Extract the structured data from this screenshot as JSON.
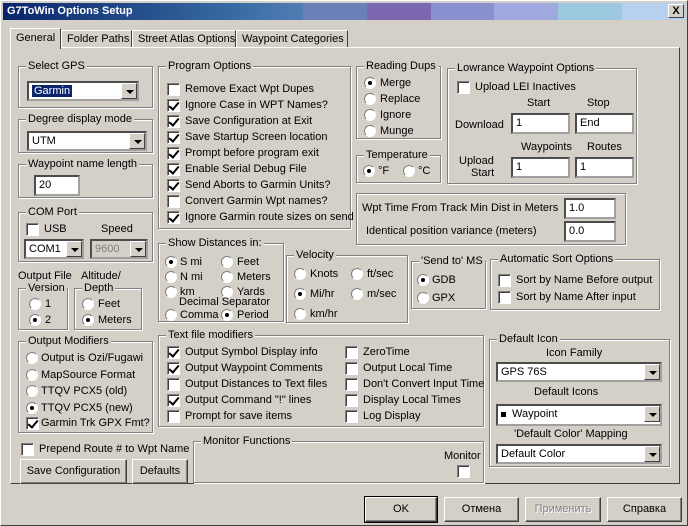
{
  "window": {
    "title": "G7ToWin Options Setup",
    "close": "X"
  },
  "tabs": [
    "General",
    "Folder Paths",
    "Street Atlas Options",
    "Waypoint  Categories"
  ],
  "select_gps": {
    "legend": "Select GPS",
    "value": "Garmin"
  },
  "degree": {
    "legend": "Degree display mode",
    "value": "UTM"
  },
  "wpt_name_len": {
    "legend": "Waypoint name length",
    "value": "20"
  },
  "com_port": {
    "legend": "COM Port",
    "usb": "USB",
    "speed_label": "Speed",
    "port": "COM1",
    "speed": "9600"
  },
  "output_file": {
    "label": "Output File",
    "version_legend": "Version",
    "v1": "1",
    "v2": "2"
  },
  "altitude": {
    "label": "Altitude/",
    "legend": "Depth",
    "feet": "Feet",
    "meters": "Meters"
  },
  "output_modifiers": {
    "legend": "Output Modifiers",
    "items": [
      "Output is Ozi/Fugawi",
      "MapSource Format",
      "TTQV PCX5 (old)",
      "TTQV PCX5 (new)",
      "Garmin Trk GPX Fmt?"
    ]
  },
  "prepend": "Prepend Route # to Wpt Name",
  "buttons": {
    "save_config": "Save Configuration",
    "defaults": "Defaults",
    "ok": "OK",
    "cancel": "Отмена",
    "apply": "Применить",
    "help": "Справка"
  },
  "program_options": {
    "legend": "Program Options",
    "items": [
      "Remove Exact Wpt Dupes",
      "Ignore Case in WPT Names?",
      "Save Configuration at Exit",
      "Save Startup Screen location",
      "Prompt before program exit",
      "Enable Serial Debug File",
      "Send Aborts to Garmin Units?",
      "Convert Garmin Wpt names?",
      "Ignore Garmin route sizes on send"
    ]
  },
  "reading_dups": {
    "legend": "Reading Dups",
    "items": [
      "Merge",
      "Replace",
      "Ignore",
      "Munge"
    ]
  },
  "temperature": {
    "legend": "Temperature",
    "f": "°F",
    "c": "°C"
  },
  "lowrance": {
    "legend": "Lowrance Waypoint Options",
    "upload_lei": "Upload LEI Inactives",
    "start": "Start",
    "stop": "Stop",
    "download": "Download",
    "download_start": "1",
    "download_stop": "End",
    "waypoints": "Waypoints",
    "routes": "Routes",
    "upload": "Upload",
    "upload_start_label": "Start",
    "upload_wpts": "1",
    "upload_routes": "1"
  },
  "wpt_time": {
    "label": "Wpt Time From Track Min Dist in Meters",
    "value": "1.0",
    "ident_label": "Identical position variance (meters)",
    "ident_value": "0.0"
  },
  "show_distances": {
    "legend": "Show Distances in:",
    "smi": "S mi",
    "nmi": "N mi",
    "km": "km",
    "feet": "Feet",
    "meters": "Meters",
    "yards": "Yards",
    "dec_sep": "Decimal Separator",
    "comma": "Comma",
    "period": "Period"
  },
  "velocity": {
    "legend": "Velocity",
    "knots": "Knots",
    "ftsec": "ft/sec",
    "mihr": "Mi/hr",
    "msec": "m/sec",
    "kmhr": "km/hr"
  },
  "send_to_ms": {
    "legend": "'Send to' MS",
    "gdb": "GDB",
    "gpx": "GPX"
  },
  "auto_sort": {
    "legend": "Automatic Sort Options",
    "before": "Sort by Name Before output",
    "after": "Sort by Name After input"
  },
  "text_modifiers": {
    "legend": "Text file modifiers",
    "left": [
      "Output Symbol Display info",
      "Output Waypoint Comments",
      "Output Distances to Text files",
      "Output Command \"!\" lines",
      "Prompt for save items"
    ],
    "right": [
      "ZeroTime",
      "Output Local Time",
      "Don't Convert Input Time",
      "Display Local Times",
      "Log Display"
    ]
  },
  "monitor": {
    "legend": "Monitor Functions",
    "label": "Monitor"
  },
  "default_icon": {
    "legend": "Default Icon",
    "family_label": "Icon Family",
    "family": "GPS 76S",
    "icons_label": "Default Icons",
    "icon": "Waypoint",
    "mapping_label": "'Default Color' Mapping",
    "mapping": "Default Color"
  },
  "colors": {
    "title_start": "#0a246a",
    "face": "#d4d0c8"
  }
}
